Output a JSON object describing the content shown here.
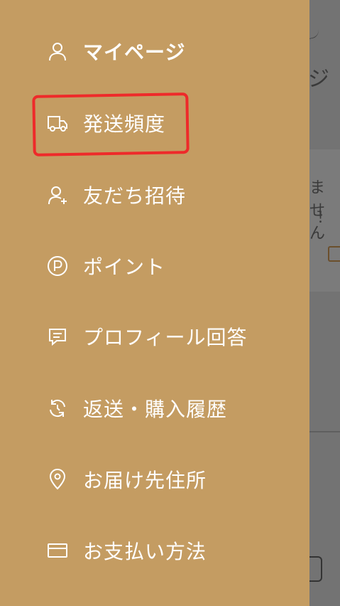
{
  "background": {
    "header_partial_text": "ジ",
    "card_partial_text_1": "ません",
    "card_partial_text_2": "！"
  },
  "menu": {
    "items": [
      {
        "label": "マイページ",
        "icon": "person-icon"
      },
      {
        "label": "発送頻度",
        "icon": "truck-icon"
      },
      {
        "label": "友だち招待",
        "icon": "add-person-icon"
      },
      {
        "label": "ポイント",
        "icon": "point-icon"
      },
      {
        "label": "プロフィール回答",
        "icon": "message-icon"
      },
      {
        "label": "返送・購入履歴",
        "icon": "refresh-icon"
      },
      {
        "label": "お届け先住所",
        "icon": "location-pin-icon"
      },
      {
        "label": "お支払い方法",
        "icon": "card-icon"
      }
    ]
  },
  "colors": {
    "drawer": "#c49c62",
    "overlay": "#737373",
    "highlight": "#ee2a2a",
    "text": "#ffffff"
  }
}
